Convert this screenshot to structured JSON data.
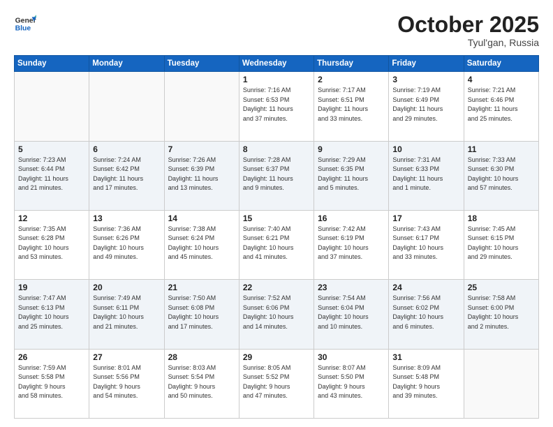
{
  "logo": {
    "line1": "General",
    "line2": "Blue"
  },
  "title": "October 2025",
  "subtitle": "Tyul'gan, Russia",
  "weekdays": [
    "Sunday",
    "Monday",
    "Tuesday",
    "Wednesday",
    "Thursday",
    "Friday",
    "Saturday"
  ],
  "weeks": [
    [
      {
        "day": "",
        "detail": ""
      },
      {
        "day": "",
        "detail": ""
      },
      {
        "day": "",
        "detail": ""
      },
      {
        "day": "1",
        "detail": "Sunrise: 7:16 AM\nSunset: 6:53 PM\nDaylight: 11 hours\nand 37 minutes."
      },
      {
        "day": "2",
        "detail": "Sunrise: 7:17 AM\nSunset: 6:51 PM\nDaylight: 11 hours\nand 33 minutes."
      },
      {
        "day": "3",
        "detail": "Sunrise: 7:19 AM\nSunset: 6:49 PM\nDaylight: 11 hours\nand 29 minutes."
      },
      {
        "day": "4",
        "detail": "Sunrise: 7:21 AM\nSunset: 6:46 PM\nDaylight: 11 hours\nand 25 minutes."
      }
    ],
    [
      {
        "day": "5",
        "detail": "Sunrise: 7:23 AM\nSunset: 6:44 PM\nDaylight: 11 hours\nand 21 minutes."
      },
      {
        "day": "6",
        "detail": "Sunrise: 7:24 AM\nSunset: 6:42 PM\nDaylight: 11 hours\nand 17 minutes."
      },
      {
        "day": "7",
        "detail": "Sunrise: 7:26 AM\nSunset: 6:39 PM\nDaylight: 11 hours\nand 13 minutes."
      },
      {
        "day": "8",
        "detail": "Sunrise: 7:28 AM\nSunset: 6:37 PM\nDaylight: 11 hours\nand 9 minutes."
      },
      {
        "day": "9",
        "detail": "Sunrise: 7:29 AM\nSunset: 6:35 PM\nDaylight: 11 hours\nand 5 minutes."
      },
      {
        "day": "10",
        "detail": "Sunrise: 7:31 AM\nSunset: 6:33 PM\nDaylight: 11 hours\nand 1 minute."
      },
      {
        "day": "11",
        "detail": "Sunrise: 7:33 AM\nSunset: 6:30 PM\nDaylight: 10 hours\nand 57 minutes."
      }
    ],
    [
      {
        "day": "12",
        "detail": "Sunrise: 7:35 AM\nSunset: 6:28 PM\nDaylight: 10 hours\nand 53 minutes."
      },
      {
        "day": "13",
        "detail": "Sunrise: 7:36 AM\nSunset: 6:26 PM\nDaylight: 10 hours\nand 49 minutes."
      },
      {
        "day": "14",
        "detail": "Sunrise: 7:38 AM\nSunset: 6:24 PM\nDaylight: 10 hours\nand 45 minutes."
      },
      {
        "day": "15",
        "detail": "Sunrise: 7:40 AM\nSunset: 6:21 PM\nDaylight: 10 hours\nand 41 minutes."
      },
      {
        "day": "16",
        "detail": "Sunrise: 7:42 AM\nSunset: 6:19 PM\nDaylight: 10 hours\nand 37 minutes."
      },
      {
        "day": "17",
        "detail": "Sunrise: 7:43 AM\nSunset: 6:17 PM\nDaylight: 10 hours\nand 33 minutes."
      },
      {
        "day": "18",
        "detail": "Sunrise: 7:45 AM\nSunset: 6:15 PM\nDaylight: 10 hours\nand 29 minutes."
      }
    ],
    [
      {
        "day": "19",
        "detail": "Sunrise: 7:47 AM\nSunset: 6:13 PM\nDaylight: 10 hours\nand 25 minutes."
      },
      {
        "day": "20",
        "detail": "Sunrise: 7:49 AM\nSunset: 6:11 PM\nDaylight: 10 hours\nand 21 minutes."
      },
      {
        "day": "21",
        "detail": "Sunrise: 7:50 AM\nSunset: 6:08 PM\nDaylight: 10 hours\nand 17 minutes."
      },
      {
        "day": "22",
        "detail": "Sunrise: 7:52 AM\nSunset: 6:06 PM\nDaylight: 10 hours\nand 14 minutes."
      },
      {
        "day": "23",
        "detail": "Sunrise: 7:54 AM\nSunset: 6:04 PM\nDaylight: 10 hours\nand 10 minutes."
      },
      {
        "day": "24",
        "detail": "Sunrise: 7:56 AM\nSunset: 6:02 PM\nDaylight: 10 hours\nand 6 minutes."
      },
      {
        "day": "25",
        "detail": "Sunrise: 7:58 AM\nSunset: 6:00 PM\nDaylight: 10 hours\nand 2 minutes."
      }
    ],
    [
      {
        "day": "26",
        "detail": "Sunrise: 7:59 AM\nSunset: 5:58 PM\nDaylight: 9 hours\nand 58 minutes."
      },
      {
        "day": "27",
        "detail": "Sunrise: 8:01 AM\nSunset: 5:56 PM\nDaylight: 9 hours\nand 54 minutes."
      },
      {
        "day": "28",
        "detail": "Sunrise: 8:03 AM\nSunset: 5:54 PM\nDaylight: 9 hours\nand 50 minutes."
      },
      {
        "day": "29",
        "detail": "Sunrise: 8:05 AM\nSunset: 5:52 PM\nDaylight: 9 hours\nand 47 minutes."
      },
      {
        "day": "30",
        "detail": "Sunrise: 8:07 AM\nSunset: 5:50 PM\nDaylight: 9 hours\nand 43 minutes."
      },
      {
        "day": "31",
        "detail": "Sunrise: 8:09 AM\nSunset: 5:48 PM\nDaylight: 9 hours\nand 39 minutes."
      },
      {
        "day": "",
        "detail": ""
      }
    ]
  ]
}
